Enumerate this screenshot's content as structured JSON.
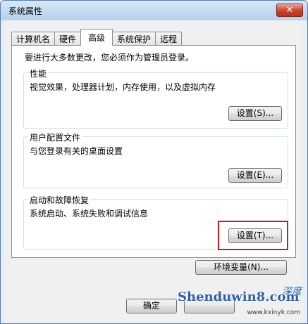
{
  "window": {
    "title": "系统属性",
    "close_label": "✕"
  },
  "tabs": [
    {
      "label": "计算机名",
      "active": false
    },
    {
      "label": "硬件",
      "active": false
    },
    {
      "label": "高级",
      "active": true
    },
    {
      "label": "系统保护",
      "active": false
    },
    {
      "label": "远程",
      "active": false
    }
  ],
  "panel": {
    "admin_note": "要进行大多数更改，您必须作为管理员登录。",
    "performance": {
      "title": "性能",
      "desc": "视觉效果，处理器计划，内存使用，以及虚拟内存",
      "button": "设置(S)..."
    },
    "profiles": {
      "title": "用户配置文件",
      "desc": "与您登录有关的桌面设置",
      "button": "设置(E)..."
    },
    "startup": {
      "title": "启动和故障恢复",
      "desc": "系统启动、系统失败和调试信息",
      "button": "设置(T)..."
    },
    "env_button": "环境变量(N)..."
  },
  "footer": {
    "ok_label": "确定"
  },
  "watermark": {
    "main": "Shenduwin8.com",
    "url": "www.kxinyk.com",
    "cn": "深度"
  },
  "colors": {
    "highlight": "#d9141c",
    "titlebar": "#b6d0ec",
    "close": "#c9402c"
  }
}
